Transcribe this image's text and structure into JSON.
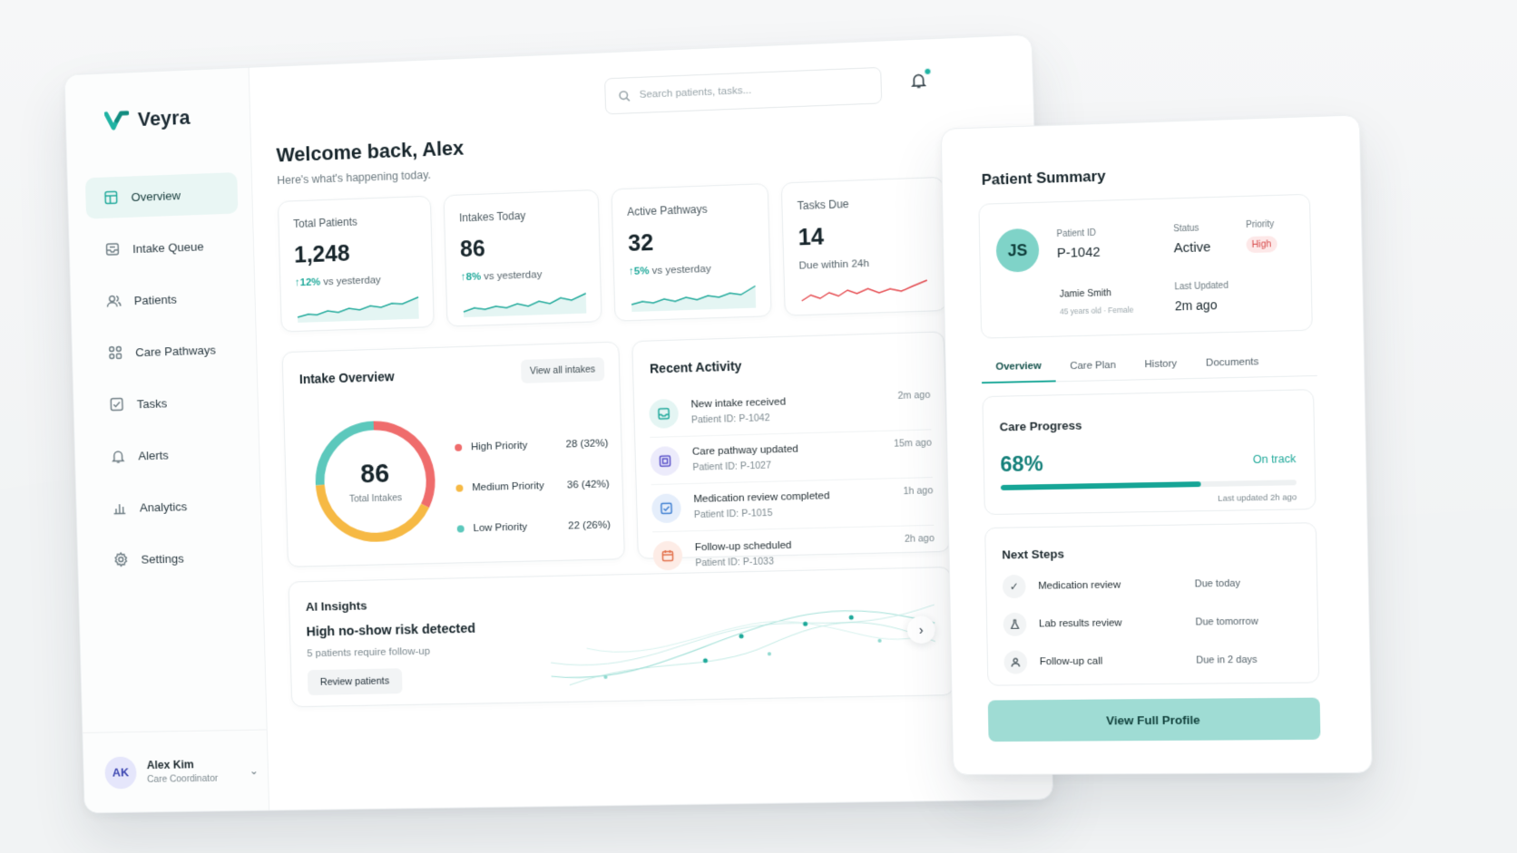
{
  "app": {
    "name": "Veyra",
    "brand_color": "#1fa99a"
  },
  "sidebar": {
    "items": [
      {
        "label": "Overview",
        "icon": "layout-icon",
        "active": true
      },
      {
        "label": "Intake Queue",
        "icon": "inbox-icon"
      },
      {
        "label": "Patients",
        "icon": "users-icon"
      },
      {
        "label": "Care Pathways",
        "icon": "grid-icon"
      },
      {
        "label": "Tasks",
        "icon": "checkbox-icon"
      },
      {
        "label": "Alerts",
        "icon": "bell-icon"
      },
      {
        "label": "Analytics",
        "icon": "bar-chart-icon"
      },
      {
        "label": "Settings",
        "icon": "gear-icon"
      }
    ],
    "user": {
      "initials": "AK",
      "name": "Alex Kim",
      "role": "Care Coordinator"
    }
  },
  "header": {
    "search_placeholder": "Search patients, tasks...",
    "notifications": 1
  },
  "welcome": {
    "title": "Welcome back, Alex",
    "subtitle": "Here's what's happening today."
  },
  "stats": [
    {
      "label": "Total Patients",
      "value": "1,248",
      "delta": "12%",
      "delta_text": "vs yesterday",
      "trend": "up",
      "color": "#1fa99a"
    },
    {
      "label": "Intakes Today",
      "value": "86",
      "delta": "8%",
      "delta_text": "vs yesterday",
      "trend": "up",
      "color": "#1fa99a"
    },
    {
      "label": "Active Pathways",
      "value": "32",
      "delta": "5%",
      "delta_text": "vs yesterday",
      "trend": "up",
      "color": "#1fa99a"
    },
    {
      "label": "Tasks Due",
      "value": "14",
      "delta": "",
      "delta_text": "Due within 24h",
      "trend": "alert",
      "color": "#e5484d"
    }
  ],
  "intake": {
    "title": "Intake Overview",
    "view_all": "View all intakes",
    "total": "86",
    "total_label": "Total Intakes",
    "segments": [
      {
        "label": "High Priority",
        "value": "28 (32%)",
        "count": 28,
        "color": "#ef6c6c"
      },
      {
        "label": "Medium Priority",
        "value": "36 (42%)",
        "count": 36,
        "color": "#f6b944"
      },
      {
        "label": "Low Priority",
        "value": "22 (26%)",
        "count": 22,
        "color": "#5cc8bc"
      }
    ]
  },
  "activity": {
    "title": "Recent Activity",
    "items": [
      {
        "title": "New intake received",
        "sub": "Patient ID: P-1042",
        "time": "2m ago",
        "icon": "inbox-icon",
        "bg": "#e4f5f3",
        "fg": "#1fa99a"
      },
      {
        "title": "Care pathway updated",
        "sub": "Patient ID: P-1027",
        "time": "15m ago",
        "icon": "pathway-icon",
        "bg": "#ecebfb",
        "fg": "#5a52c9"
      },
      {
        "title": "Medication review completed",
        "sub": "Patient ID: P-1015",
        "time": "1h ago",
        "icon": "check-square-icon",
        "bg": "#e5eefb",
        "fg": "#3f7fd1"
      },
      {
        "title": "Follow-up scheduled",
        "sub": "Patient ID: P-1033",
        "time": "2h ago",
        "icon": "calendar-icon",
        "bg": "#fdece6",
        "fg": "#e2704b"
      }
    ]
  },
  "ai": {
    "title": "AI Insights",
    "headline": "High no-show risk detected",
    "sub": "5 patients require follow-up",
    "button": "Review patients"
  },
  "patient_summary": {
    "title": "Patient Summary",
    "initials": "JS",
    "id_label": "Patient ID",
    "id": "P-1042",
    "name": "Jamie Smith",
    "demographics": "45 years old · Female",
    "status_label": "Status",
    "status": "Active",
    "priority_label": "Priority",
    "priority": "High",
    "updated_label": "Last Updated",
    "updated": "2m ago",
    "tabs": [
      "Overview",
      "Care Plan",
      "History",
      "Documents"
    ],
    "progress": {
      "title": "Care Progress",
      "value": "68%",
      "fraction": 0.68,
      "status": "On track",
      "updated": "Last updated 2h ago"
    },
    "next_steps": {
      "title": "Next Steps",
      "items": [
        {
          "label": "Medication review",
          "due": "Due today",
          "icon": "check-icon"
        },
        {
          "label": "Lab results review",
          "due": "Due tomorrow",
          "icon": "flask-icon"
        },
        {
          "label": "Follow-up call",
          "due": "Due in 2 days",
          "icon": "user-icon"
        }
      ]
    },
    "cta": "View Full Profile"
  }
}
